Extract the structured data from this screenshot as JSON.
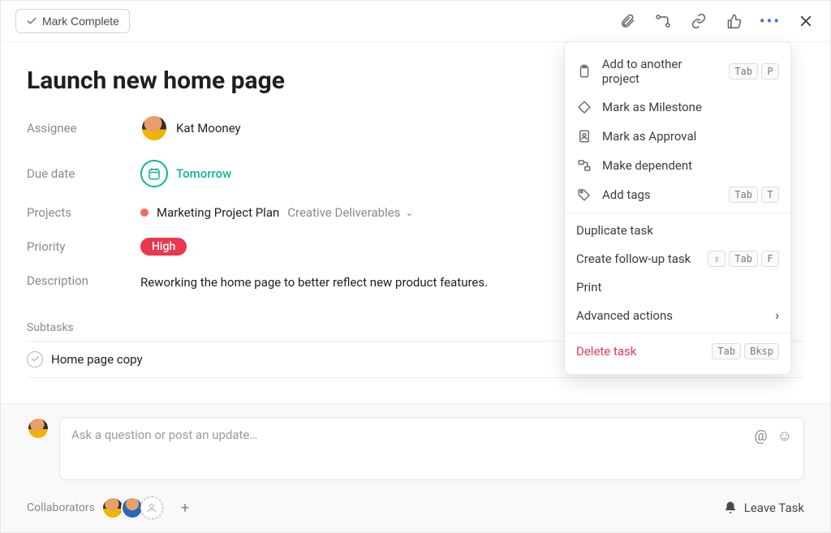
{
  "topbar": {
    "complete_label": "Mark Complete"
  },
  "task": {
    "title": "Launch new home page",
    "labels": {
      "assignee": "Assignee",
      "due_date": "Due date",
      "projects": "Projects",
      "priority": "Priority",
      "description": "Description",
      "subtasks": "Subtasks"
    },
    "assignee": "Kat Mooney",
    "due_date": "Tomorrow",
    "project_name": "Marketing Project Plan",
    "project_section": "Creative Deliverables",
    "priority": "High",
    "description": "Reworking the home page to better reflect new product features.",
    "subtasks": [
      "Home page copy"
    ]
  },
  "comment": {
    "placeholder": "Ask a question or post an update…",
    "collaborators_label": "Collaborators",
    "leave_label": "Leave Task"
  },
  "menu": {
    "section1": [
      {
        "icon": "clipboard",
        "label": "Add to another project",
        "keys": [
          "Tab",
          "P"
        ]
      },
      {
        "icon": "diamond",
        "label": "Mark as Milestone"
      },
      {
        "icon": "approval",
        "label": "Mark as Approval"
      },
      {
        "icon": "depend",
        "label": "Make dependent"
      },
      {
        "icon": "tag",
        "label": "Add tags",
        "keys": [
          "Tab",
          "T"
        ]
      }
    ],
    "section2": [
      {
        "label": "Duplicate task"
      },
      {
        "label": "Create follow-up task",
        "keys": [
          "⇧",
          "Tab",
          "F"
        ]
      },
      {
        "label": "Print"
      },
      {
        "label": "Advanced actions",
        "chevron": true
      }
    ],
    "section3": [
      {
        "label": "Delete task",
        "danger": true,
        "keys": [
          "Tab",
          "Bksp"
        ]
      }
    ]
  }
}
